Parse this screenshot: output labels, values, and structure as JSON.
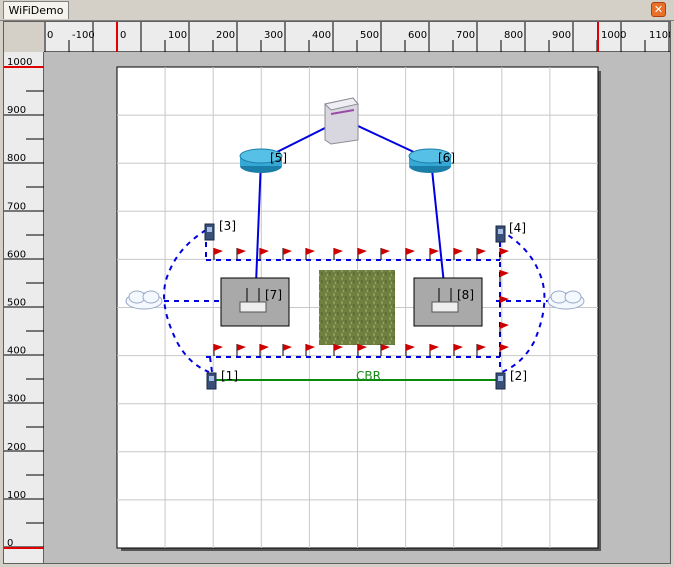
{
  "tab": {
    "label": "WiFiDemo"
  },
  "close_icon": "close-icon",
  "hruler": {
    "labels": [
      "0",
      "-100",
      "0",
      "100",
      "200",
      "300",
      "400",
      "500",
      "600",
      "700",
      "800",
      "900",
      "1000",
      "1100"
    ]
  },
  "vruler": {
    "labels": [
      "1000",
      "900",
      "800",
      "700",
      "600",
      "500",
      "400",
      "300",
      "200",
      "100",
      "0"
    ]
  },
  "nodes": {
    "n1": {
      "label": "[1]",
      "icon": "mobile-phone-icon"
    },
    "n2": {
      "label": "[2]",
      "icon": "mobile-phone-icon"
    },
    "n3": {
      "label": "[3]",
      "icon": "mobile-phone-icon"
    },
    "n4": {
      "label": "[4]",
      "icon": "mobile-phone-icon"
    },
    "n5": {
      "label": "[5]",
      "icon": "router-icon"
    },
    "n6": {
      "label": "[6]",
      "icon": "router-icon"
    },
    "n7": {
      "label": "[7]",
      "icon": "access-point-icon"
    },
    "n8": {
      "label": "[8]",
      "icon": "access-point-icon"
    },
    "server": {
      "icon": "server-icon"
    }
  },
  "links": {
    "cbr_label": "CBR"
  },
  "colors": {
    "wired": "#0000e0",
    "wireless": "#0000e0",
    "cbr": "#0a8a0a",
    "flag": "#cc0000",
    "ruler_red": "#e00000"
  }
}
